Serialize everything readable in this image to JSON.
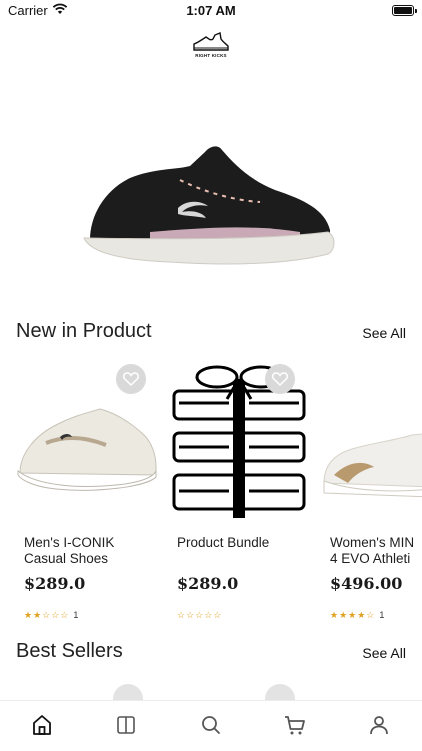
{
  "status_bar": {
    "carrier": "Carrier",
    "time": "1:07 AM"
  },
  "logo": {
    "text": "RIGHT KICKS"
  },
  "sections": {
    "new_in": {
      "title": "New in Product",
      "see_all": "See All"
    },
    "best_sellers": {
      "title": "Best Sellers",
      "see_all": "See All"
    }
  },
  "products": [
    {
      "name": "Men's I-CONIK\nCasual Shoes",
      "price": "$289.0",
      "stars": "★★☆☆☆",
      "rating_count": "1",
      "rating": 2.5
    },
    {
      "name": "Product Bundle",
      "price": "$289.0",
      "stars": "☆☆☆☆☆",
      "rating_count": "",
      "rating": 0
    },
    {
      "name": "Women's MIN\n4 EVO Athleti",
      "price": "$496.00",
      "stars": "★★★★☆",
      "rating_count": "1",
      "rating": 4.5
    }
  ],
  "tabs": [
    "home-icon",
    "catalog-icon",
    "search-icon",
    "cart-icon",
    "profile-icon"
  ],
  "colors": {
    "accent": "#e0a020",
    "heart_bg": "#d9d9d9",
    "shoe": "#1c1c1c",
    "sole": "#e9e7e2"
  }
}
